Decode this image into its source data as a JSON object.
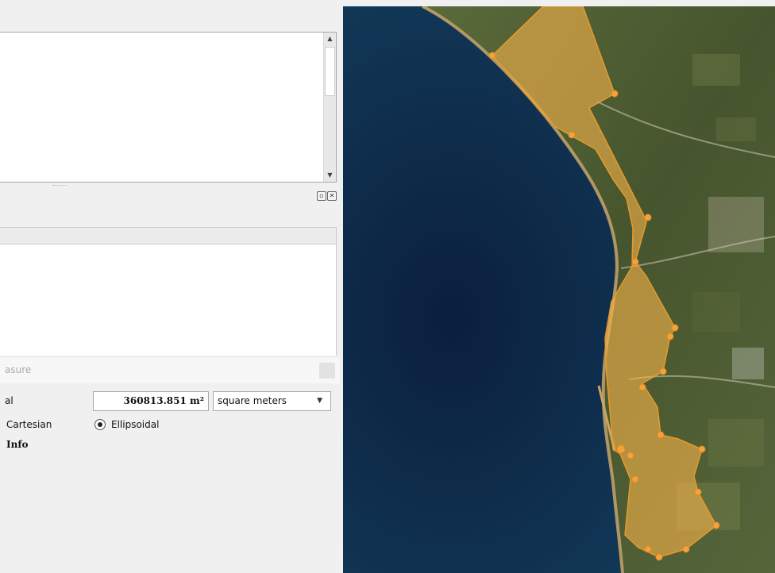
{
  "measure_panel": {
    "title_fragment": "asure",
    "total_label_fragment": "al",
    "total_value": "360813.851 m²",
    "units_selected": "square meters",
    "radio_cartesian_label": "Cartesian",
    "radio_ellipsoidal_label": "Ellipsoidal",
    "radio_selected": "Ellipsoidal",
    "info_label": "Info"
  },
  "icons": {
    "dock_float": "float-window-icon",
    "dock_close": "close-icon",
    "map_vertex": "vertex-icon"
  },
  "colors": {
    "measure_fill": "#f3b24a",
    "measure_outline": "#e79a2a",
    "sea": "#0d2b4a",
    "land": "#4b5a33",
    "panel_bg": "#f0f0f0"
  }
}
